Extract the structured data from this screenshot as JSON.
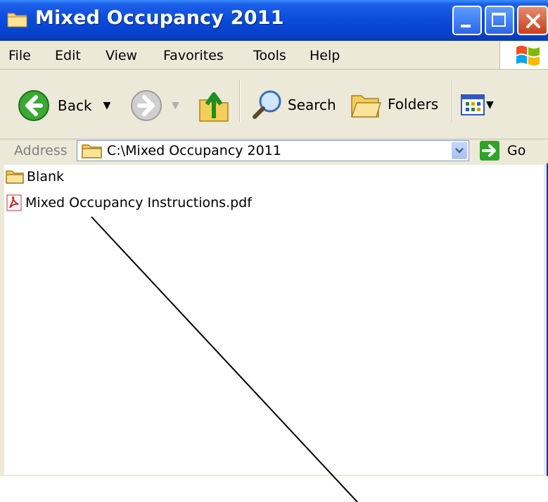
{
  "window": {
    "title": "Mixed Occupancy 2011"
  },
  "menu": {
    "items": [
      "File",
      "Edit",
      "View",
      "Favorites",
      "Tools",
      "Help"
    ]
  },
  "toolbar": {
    "back_label": "Back",
    "search_label": "Search",
    "folders_label": "Folders"
  },
  "address": {
    "label": "Address",
    "value": "C:\\Mixed Occupancy 2011",
    "go_label": "Go"
  },
  "files": [
    {
      "name": "Blank",
      "icon": "folder-icon"
    },
    {
      "name": "Mixed Occupancy Instructions.pdf",
      "icon": "pdf-icon"
    }
  ],
  "colors": {
    "titlebar": "#0a4bd8",
    "chrome": "#ece9d8",
    "close_button": "#c4401c"
  }
}
